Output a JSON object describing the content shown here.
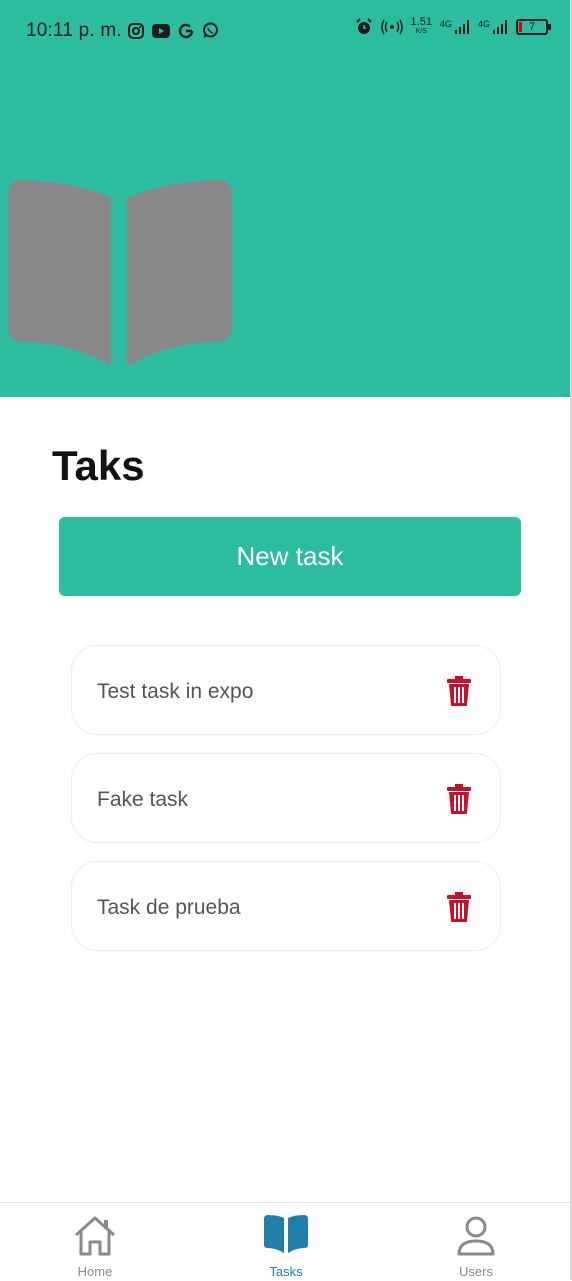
{
  "status_bar": {
    "time": "10:11 p. m.",
    "left_icons": [
      "instagram-icon",
      "youtube-icon",
      "google-icon",
      "whatsapp-icon"
    ],
    "speed": "1.51",
    "speed_unit": "K/S",
    "network_1": "4G",
    "network_2": "4G",
    "battery": "7"
  },
  "colors": {
    "accent": "#2cbca0",
    "delete": "#c8102e",
    "nav_active": "#1f7fa8",
    "nav_inactive": "#8a8a8a"
  },
  "page": {
    "title": "Taks",
    "new_task_label": "New task"
  },
  "tasks": [
    {
      "label": "Test task in expo"
    },
    {
      "label": "Fake task"
    },
    {
      "label": "Task de prueba"
    }
  ],
  "nav": [
    {
      "label": "Home",
      "icon": "home-icon",
      "active": false
    },
    {
      "label": "Tasks",
      "icon": "book-icon",
      "active": true
    },
    {
      "label": "Users",
      "icon": "user-icon",
      "active": false
    }
  ]
}
